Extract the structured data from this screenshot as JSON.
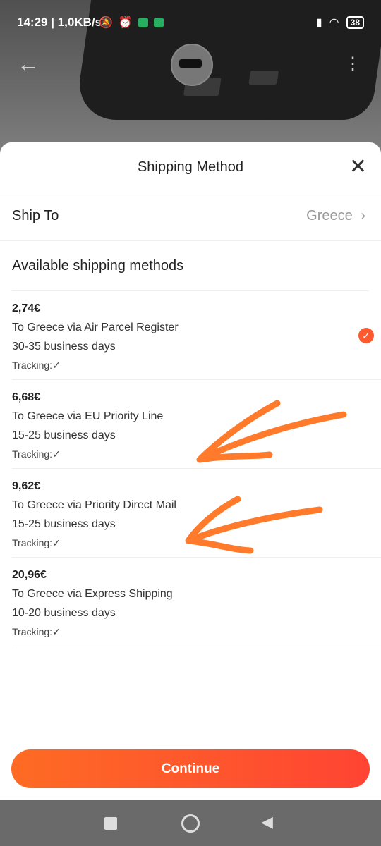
{
  "status": {
    "time": "14:29",
    "speed": "1,0KB/s",
    "battery": "38"
  },
  "sheet": {
    "title": "Shipping Method"
  },
  "ship_to": {
    "label": "Ship To",
    "value": "Greece"
  },
  "available_label": "Available shipping methods",
  "methods": [
    {
      "price": "2,74€",
      "route": "To Greece via Air Parcel Register",
      "days": "30-35 business days",
      "tracking": "Tracking:",
      "selected": true
    },
    {
      "price": "6,68€",
      "route": "To Greece via EU Priority Line",
      "days": "15-25 business days",
      "tracking": "Tracking:",
      "selected": false
    },
    {
      "price": "9,62€",
      "route": "To Greece via Priority Direct Mail",
      "days": "15-25 business days",
      "tracking": "Tracking:",
      "selected": false
    },
    {
      "price": "20,96€",
      "route": "To Greece via Express Shipping",
      "days": "10-20 business days",
      "tracking": "Tracking:",
      "selected": false
    }
  ],
  "continue_label": "Continue",
  "colors": {
    "accent": "#fe5a30",
    "annotation": "#ff7a2a"
  }
}
